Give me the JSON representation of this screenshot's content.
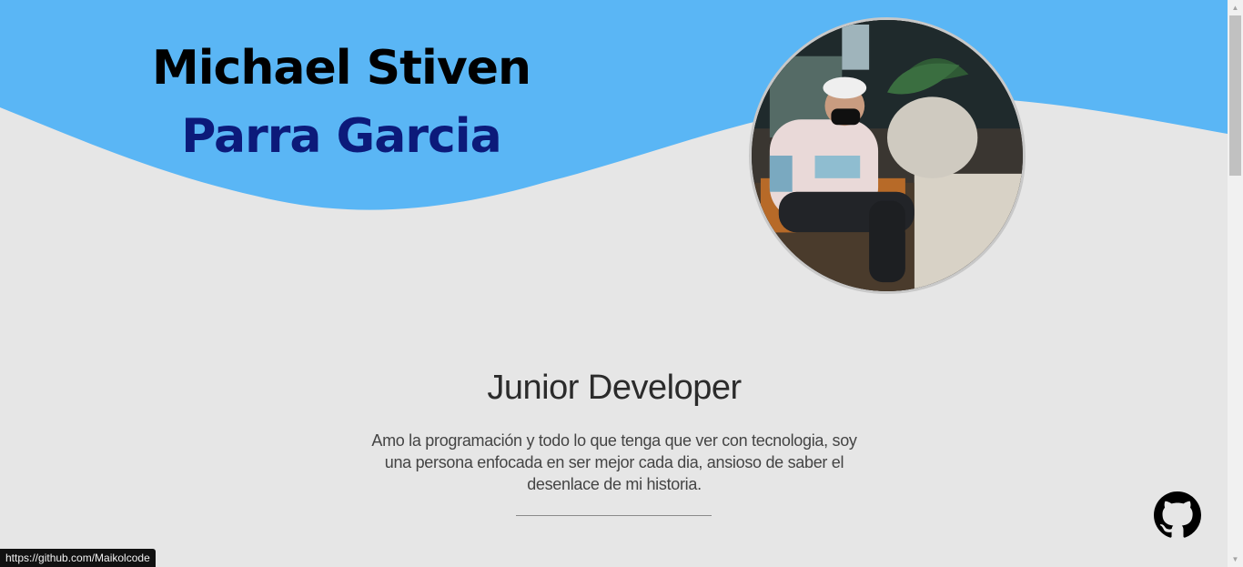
{
  "header": {
    "name_first": "Michael Stiven",
    "name_last": "Parra Garcia",
    "photo_alt": "Foto de perfil"
  },
  "main": {
    "role": "Junior Developer",
    "bio": "Amo la programación y todo lo que tenga que ver con tecnologia, soy una persona enfocada en ser mejor cada dia, ansioso de saber el desenlace de mi historia."
  },
  "social": {
    "github_icon": "github-icon"
  },
  "status": {
    "link_url": "https://github.com/Maikolcode"
  },
  "colors": {
    "wave": "#5ab6f5",
    "background": "#e6e6e6",
    "name_last": "#0c1a7a"
  }
}
